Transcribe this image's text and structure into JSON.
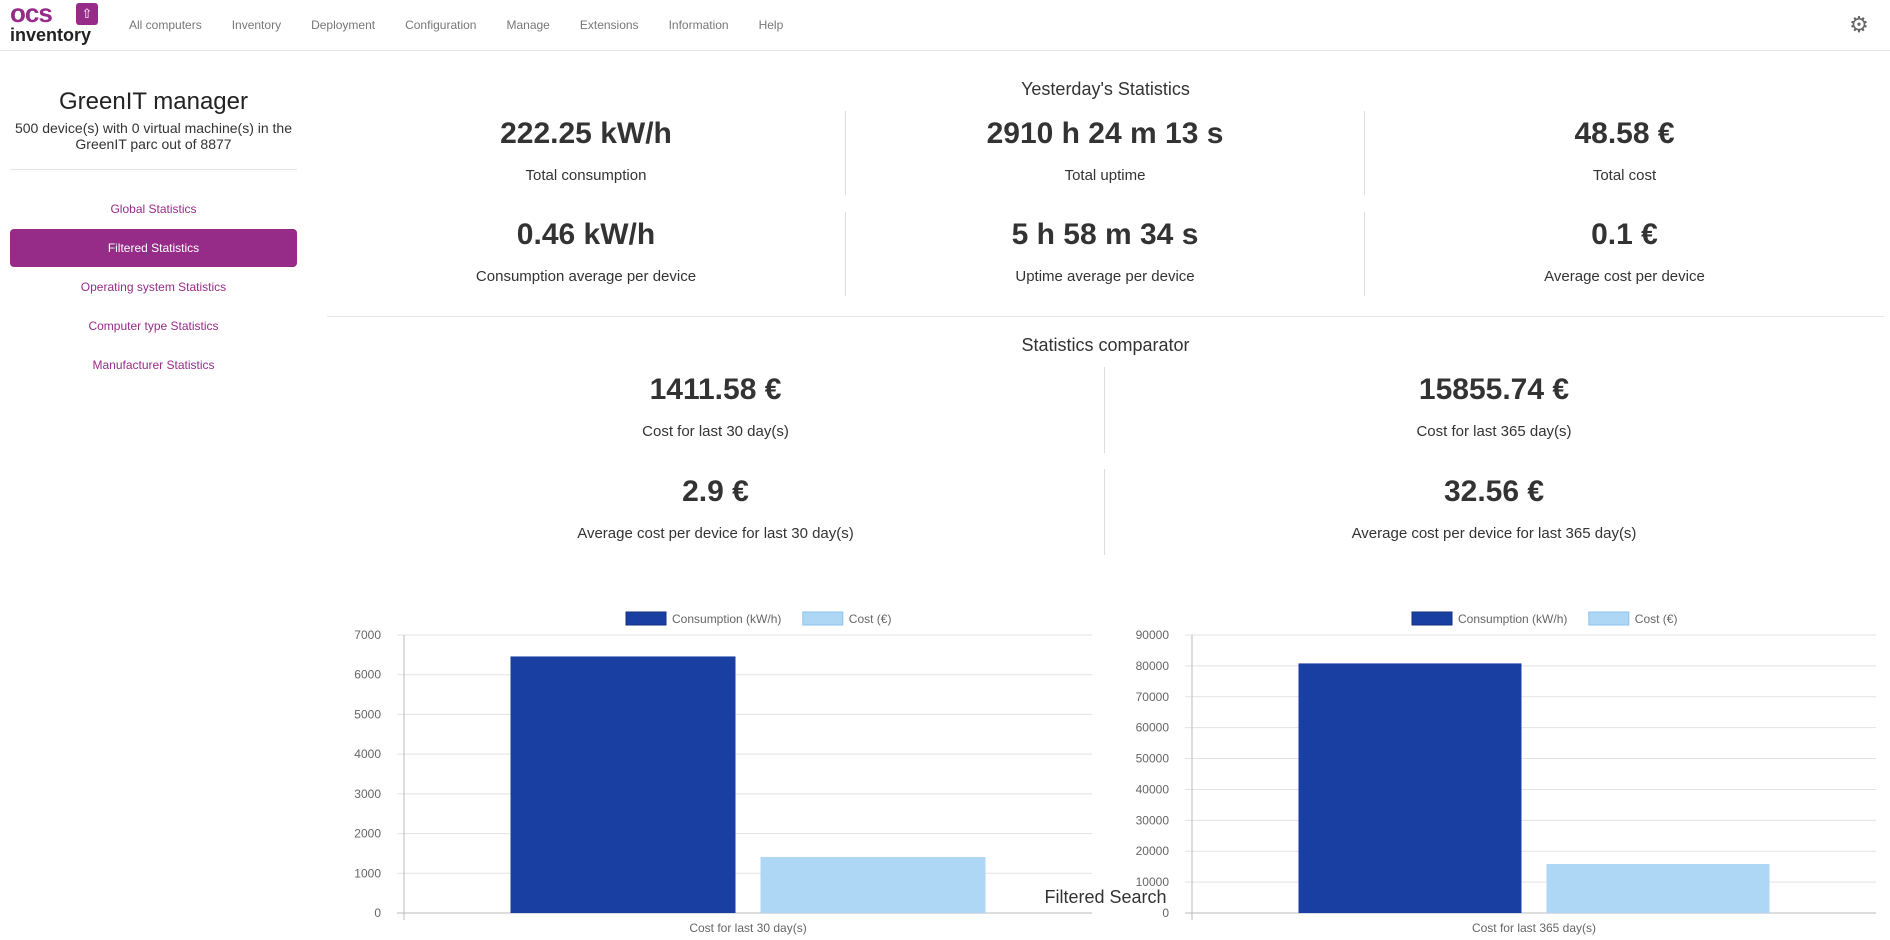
{
  "navbar": {
    "logo": {
      "word1": "ocs",
      "word2": "inventory"
    },
    "items": [
      "All computers",
      "Inventory",
      "Deployment",
      "Configuration",
      "Manage",
      "Extensions",
      "Information",
      "Help"
    ],
    "settings_icon": "gear-icon"
  },
  "sidebar": {
    "title": "GreenIT manager",
    "subtitle": "500 device(s) with 0 virtual machine(s) in the GreenIT parc out of 8877",
    "items": [
      {
        "label": "Global Statistics",
        "active": false
      },
      {
        "label": "Filtered Statistics",
        "active": true
      },
      {
        "label": "Operating system Statistics",
        "active": false
      },
      {
        "label": "Computer type Statistics",
        "active": false
      },
      {
        "label": "Manufacturer Statistics",
        "active": false
      }
    ]
  },
  "yesterday": {
    "title": "Yesterday's Statistics",
    "row1": [
      {
        "value": "222.25 kW/h",
        "label": "Total consumption"
      },
      {
        "value": "2910 h 24 m 13 s",
        "label": "Total uptime"
      },
      {
        "value": "48.58 €",
        "label": "Total cost"
      }
    ],
    "row2": [
      {
        "value": "0.46 kW/h",
        "label": "Consumption average per device"
      },
      {
        "value": "5 h 58 m 34 s",
        "label": "Uptime average per device"
      },
      {
        "value": "0.1 €",
        "label": "Average cost per device"
      }
    ]
  },
  "comparator": {
    "title": "Statistics comparator",
    "row1": [
      {
        "value": "1411.58 €",
        "label": "Cost for last 30 day(s)"
      },
      {
        "value": "15855.74 €",
        "label": "Cost for last 365 day(s)"
      }
    ],
    "row2": [
      {
        "value": "2.9 €",
        "label": "Average cost per device for last 30 day(s)"
      },
      {
        "value": "32.56 €",
        "label": "Average cost per device for last 365 day(s)"
      }
    ]
  },
  "colors": {
    "accent": "#962c88",
    "consumption": "#1a3fa3",
    "cost": "#aed6f5"
  },
  "chart_data": [
    {
      "type": "bar",
      "categories": [
        "Cost for last 30 day(s)"
      ],
      "series": [
        {
          "name": "Consumption (kW/h)",
          "values": [
            6460
          ]
        },
        {
          "name": "Cost (€)",
          "values": [
            1411.58
          ]
        }
      ],
      "ylim": [
        0,
        7000
      ],
      "yticks": [
        0,
        1000,
        2000,
        3000,
        4000,
        5000,
        6000,
        7000
      ],
      "legend": "top-center",
      "grid": true
    },
    {
      "type": "bar",
      "categories": [
        "Cost for last 365 day(s)"
      ],
      "series": [
        {
          "name": "Consumption (kW/h)",
          "values": [
            80800
          ]
        },
        {
          "name": "Cost (€)",
          "values": [
            15855.74
          ]
        }
      ],
      "ylim": [
        0,
        90000
      ],
      "yticks": [
        0,
        10000,
        20000,
        30000,
        40000,
        50000,
        60000,
        70000,
        80000,
        90000
      ],
      "legend": "top-center",
      "grid": true
    }
  ],
  "filtered": {
    "title": "Filtered Search"
  }
}
